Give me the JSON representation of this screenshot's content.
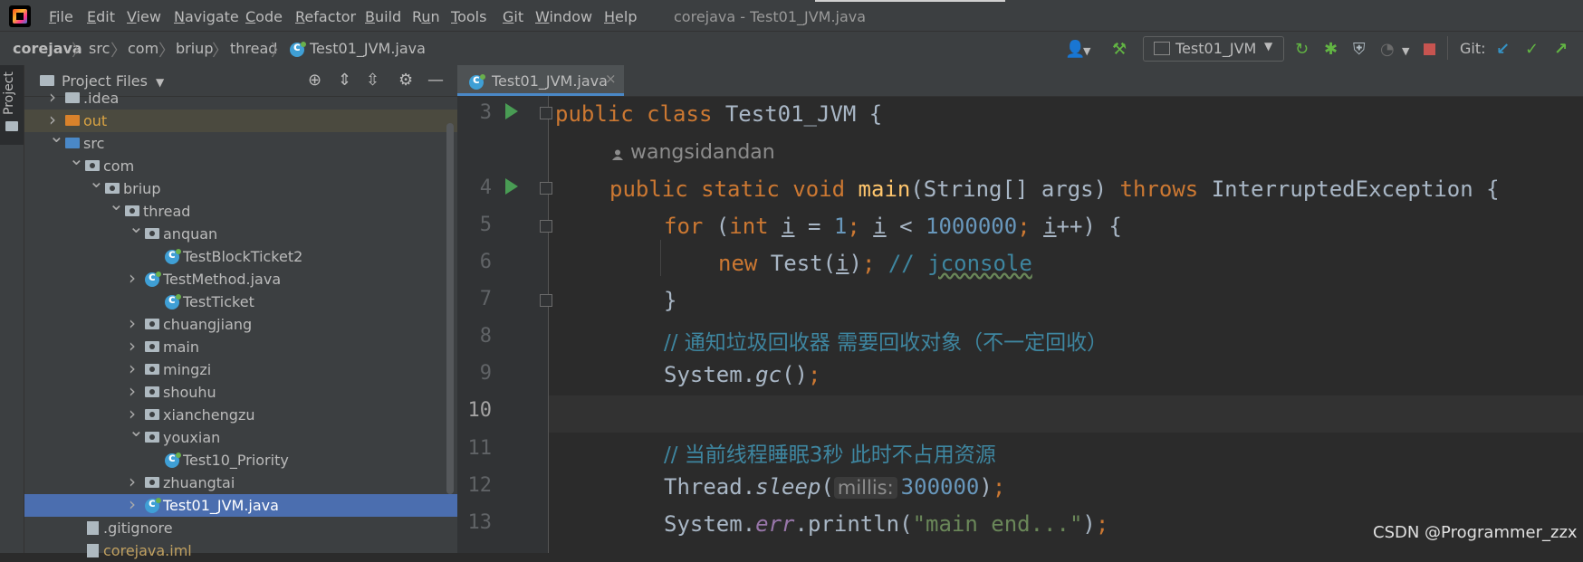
{
  "app": {
    "window_title": "corejava - Test01_JVM.java",
    "menu": [
      {
        "pre": "",
        "m": "F",
        "post": "ile"
      },
      {
        "pre": "",
        "m": "E",
        "post": "dit"
      },
      {
        "pre": "",
        "m": "V",
        "post": "iew"
      },
      {
        "pre": "",
        "m": "N",
        "post": "avigate"
      },
      {
        "pre": "",
        "m": "C",
        "post": "ode"
      },
      {
        "pre": "",
        "m": "R",
        "post": "efactor"
      },
      {
        "pre": "",
        "m": "B",
        "post": "uild"
      },
      {
        "pre": "R",
        "m": "u",
        "post": "n"
      },
      {
        "pre": "",
        "m": "T",
        "post": "ools"
      },
      {
        "pre": "",
        "m": "G",
        "post": "it"
      },
      {
        "pre": "",
        "m": "W",
        "post": "indow"
      },
      {
        "pre": "",
        "m": "H",
        "post": "elp"
      }
    ]
  },
  "breadcrumb": [
    "corejava",
    "src",
    "com",
    "briup",
    "thread",
    "Test01_JVM.java"
  ],
  "toolbar": {
    "run_config": "Test01_JVM",
    "git_label": "Git:"
  },
  "left_stripe": {
    "project_label": "Project"
  },
  "project_panel": {
    "title": "Project Files",
    "tree": [
      {
        "label": ".idea",
        "arrow": ">",
        "icon": "folder"
      },
      {
        "label": "out",
        "arrow": ">",
        "icon": "folder-orange"
      },
      {
        "label": "src",
        "arrow": "v",
        "icon": "folder-blue"
      },
      {
        "label": "com",
        "arrow": "v",
        "icon": "package"
      },
      {
        "label": "briup",
        "arrow": "v",
        "icon": "package"
      },
      {
        "label": "thread",
        "arrow": "v",
        "icon": "package"
      },
      {
        "label": "anquan",
        "arrow": "v",
        "icon": "package"
      },
      {
        "label": "TestBlockTicket2",
        "arrow": "",
        "icon": "java-class"
      },
      {
        "label": "TestMethod.java",
        "arrow": ">",
        "icon": "java-class"
      },
      {
        "label": "TestTicket",
        "arrow": "",
        "icon": "java-class"
      },
      {
        "label": "chuangjiang",
        "arrow": ">",
        "icon": "package"
      },
      {
        "label": "main",
        "arrow": ">",
        "icon": "package"
      },
      {
        "label": "mingzi",
        "arrow": ">",
        "icon": "package"
      },
      {
        "label": "shouhu",
        "arrow": ">",
        "icon": "package"
      },
      {
        "label": "xianchengzu",
        "arrow": ">",
        "icon": "package"
      },
      {
        "label": "youxian",
        "arrow": "v",
        "icon": "package"
      },
      {
        "label": "Test10_Priority",
        "arrow": "",
        "icon": "java-class"
      },
      {
        "label": "zhuangtai",
        "arrow": ">",
        "icon": "package"
      },
      {
        "label": "Test01_JVM.java",
        "arrow": ">",
        "icon": "java-class"
      },
      {
        "label": ".gitignore",
        "arrow": "",
        "icon": "file"
      },
      {
        "label": "corejava.iml",
        "arrow": "",
        "icon": "file"
      }
    ]
  },
  "editor": {
    "tab_label": "Test01_JVM.java",
    "tab_close": "×",
    "author": "wangsidandan",
    "line_numbers": [
      "3",
      "4",
      "5",
      "6",
      "7",
      "8",
      "9",
      "10",
      "11",
      "12",
      "13"
    ],
    "code": {
      "l3_kw": "public class ",
      "l3_name": "Test01_JVM {",
      "l4_mods": "public static void ",
      "l4_main": "main",
      "l4_params": "(String[] args) ",
      "l4_throws": "throws ",
      "l4_exc": "InterruptedException {",
      "l5_for": "for ",
      "l5_open": "(",
      "l5_int": "int ",
      "l5_i": "i",
      "l5_eq": " = ",
      "l5_one": "1",
      "l5_semi1": "; ",
      "l5_i2": "i",
      "l5_lt": " < ",
      "l5_big": "1000000",
      "l5_semi2": "; ",
      "l5_i3": "i",
      "l5_inc": "++) {",
      "l6_new": "new ",
      "l6_test": "Test(",
      "l6_i": "i",
      "l6_close": ")",
      "l6_semi": "; ",
      "l6_cm": "// ",
      "l6_cmw": "jconsole",
      "l7_brace": "}",
      "l8_cm": "// 通知垃圾回收器 需要回收对象（不一定回收）",
      "l9_sys": "System.",
      "l9_gc": "gc",
      "l9_paren": "()",
      "l9_semi": ";",
      "l11_cm": "// 当前线程睡眠3秒 此时不占用资源",
      "l12_thread": "Thread.",
      "l12_sleep": "sleep",
      "l12_open": "(",
      "l12_hint": "millis:",
      "l12_num": "300000",
      "l12_close": ")",
      "l12_semi": ";",
      "l13_sys": "System.",
      "l13_err": "err",
      "l13_println": ".println(",
      "l13_str": "\"main end...\"",
      "l13_close": ")",
      "l13_semi": ";"
    }
  },
  "watermark": "CSDN @Programmer_zzx",
  "colors": {
    "accent": "#4a88c7",
    "run_green": "#499c54",
    "stop_red": "#c75450"
  }
}
